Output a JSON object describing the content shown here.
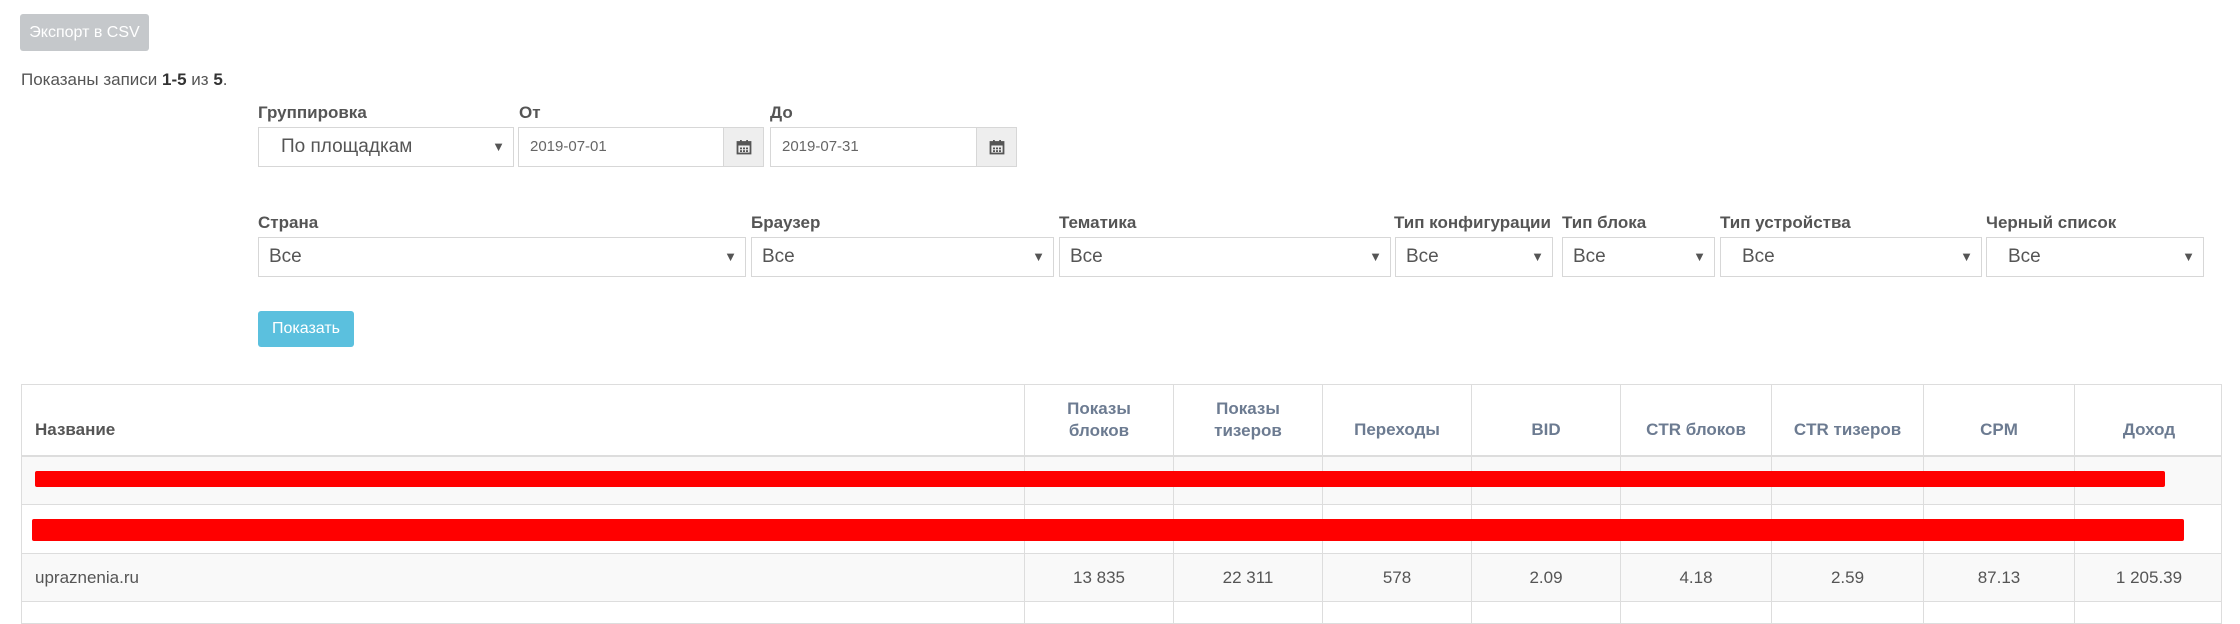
{
  "toolbar": {
    "export_label": "Экспорт в CSV"
  },
  "summary": {
    "prefix": "Показаны записи ",
    "range": "1-5",
    "middle": " из ",
    "total": "5",
    "suffix": "."
  },
  "filters": {
    "grouping": {
      "label": "Группировка",
      "value": "По площадкам"
    },
    "from": {
      "label": "От",
      "value": "2019-07-01"
    },
    "to": {
      "label": "До",
      "value": "2019-07-31"
    },
    "country": {
      "label": "Страна",
      "value": "Все"
    },
    "browser": {
      "label": "Браузер",
      "value": "Все"
    },
    "topic": {
      "label": "Тематика",
      "value": "Все"
    },
    "config_type": {
      "label": "Тип конфигурации",
      "value": "Все"
    },
    "block_type": {
      "label": "Тип блока",
      "value": "Все"
    },
    "device_type": {
      "label": "Тип устройства",
      "value": "Все"
    },
    "blacklist": {
      "label": "Черный список",
      "value": "Все"
    },
    "show_label": "Показать"
  },
  "table": {
    "columns": {
      "name": "Название",
      "block_impressions": "Показы блоков",
      "teaser_impressions": "Показы тизеров",
      "clicks": "Переходы",
      "bid": "BID",
      "ctr_blocks": "CTR блоков",
      "ctr_teasers": "CTR тизеров",
      "cpm": "CPM",
      "income": "Доход"
    },
    "rows": [
      {
        "name": "upraznenia.ru",
        "block_impressions": "13 835",
        "teaser_impressions": "22 311",
        "clicks": "578",
        "bid": "2.09",
        "ctr_blocks": "4.18",
        "ctr_teasers": "2.59",
        "cpm": "87.13",
        "income": "1 205.39"
      }
    ]
  },
  "colors": {
    "accent": "#5bc0de",
    "redaction": "#ff0000",
    "header_text": "#6c7b91"
  }
}
